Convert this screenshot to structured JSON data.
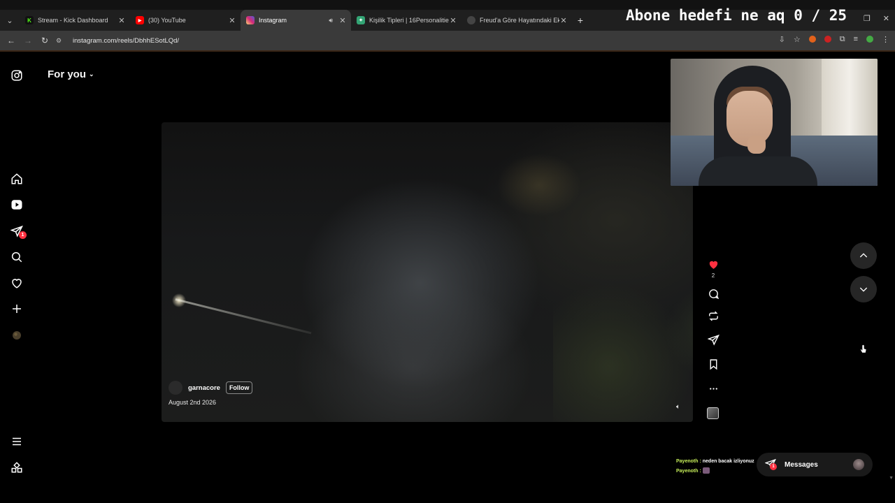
{
  "browser": {
    "tabs": [
      {
        "title": "Stream - Kick Dashboard",
        "favicon": "kick-icon",
        "color": "#53fc18",
        "active": false
      },
      {
        "title": "(30) YouTube",
        "favicon": "youtube-icon",
        "color": "#ff0000",
        "active": false
      },
      {
        "title": "Instagram",
        "favicon": "instagram-icon",
        "color": "#d62976",
        "active": true,
        "audio": true
      },
      {
        "title": "Kişilik Tipleri | 16Personalities",
        "favicon": "16personalities-icon",
        "color": "#33a474",
        "active": false
      },
      {
        "title": "Freud'a Göre Hayatındaki Eksik",
        "favicon": "generic-icon",
        "color": "#444444",
        "active": false
      }
    ],
    "url": "instagram.com/reels/DbhhESotLQd/",
    "stream_overlay": "Abone hedefi ne aq 0 / 25"
  },
  "instagram": {
    "feed_title": "For you",
    "nav_items": [
      {
        "name": "home-icon"
      },
      {
        "name": "reels-icon"
      },
      {
        "name": "direct-icon",
        "badge": "1"
      },
      {
        "name": "search-icon"
      },
      {
        "name": "notifications-icon"
      },
      {
        "name": "create-icon"
      },
      {
        "name": "profile-icon"
      }
    ],
    "reel": {
      "username": "garnacore",
      "follow_label": "Follow",
      "date": "August 2nd 2026",
      "likes": "2",
      "liked": true
    },
    "chat": [
      {
        "name": "Payenoth :",
        "message": "neden bacak izliyonuz"
      },
      {
        "name": "Payenoth :",
        "message": ""
      }
    ],
    "messages_label": "Messages",
    "messages_badge": "1"
  },
  "colors": {
    "like_red": "#ff3040",
    "chat_name": "#c8f05a"
  }
}
